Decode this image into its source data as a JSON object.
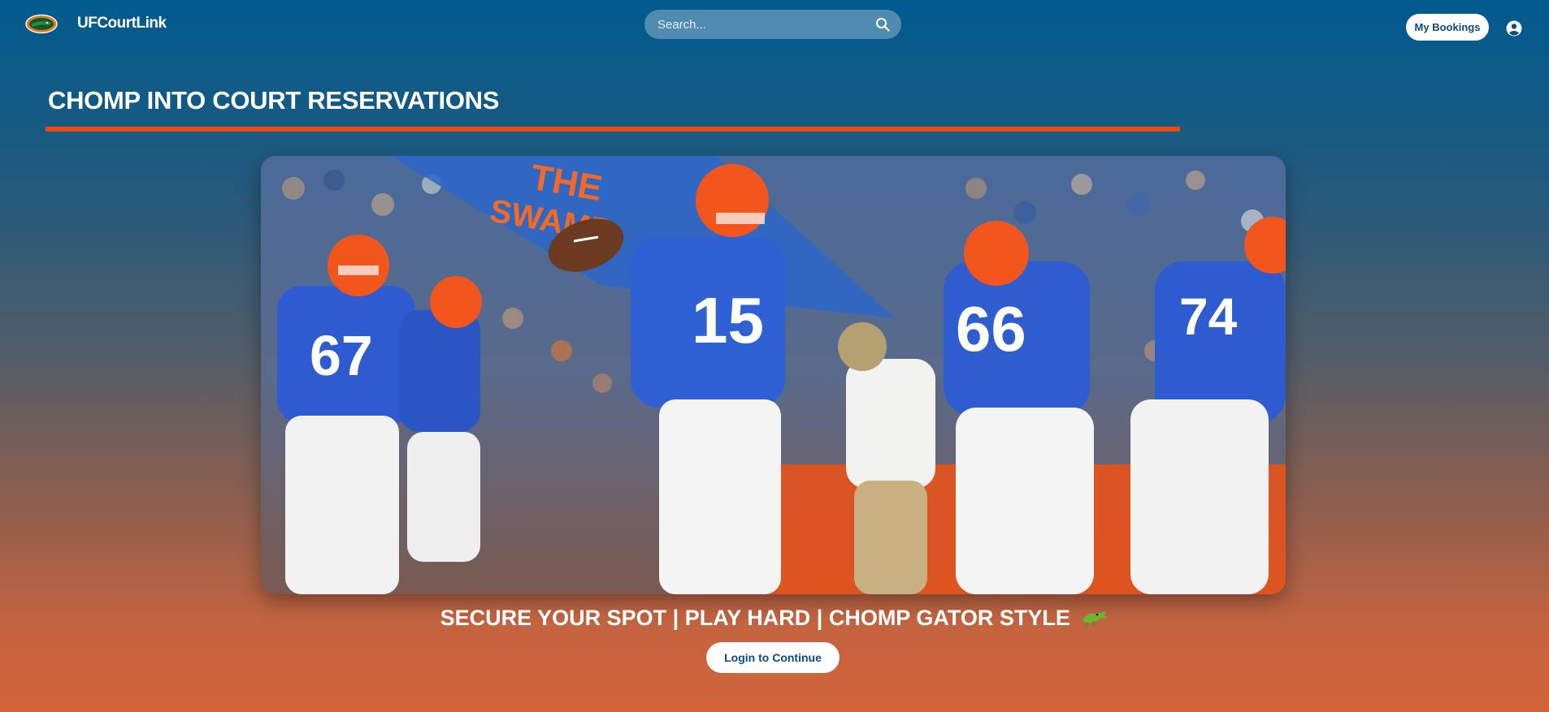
{
  "navbar": {
    "brand": "UFCourtLink",
    "logo_icon": "gator-logo-icon",
    "search": {
      "placeholder": "Search...",
      "value": "",
      "icon": "search-icon"
    },
    "bookings_label": "My Bookings",
    "account_icon": "account-circle-icon"
  },
  "hero": {
    "title": "CHOMP INTO COURT RESERVATIONS",
    "image_alt": "Florida Gators football game photo",
    "tagline": "SECURE YOUR SPOT | PLAY HARD | CHOMP GATOR STYLE",
    "tagline_icon": "gator-emoji-icon",
    "login_label": "Login to Continue"
  },
  "colors": {
    "accent_orange": "#f04a14",
    "gator_blue": "#0b4c7a",
    "search_bg": "#4f8cb0"
  }
}
